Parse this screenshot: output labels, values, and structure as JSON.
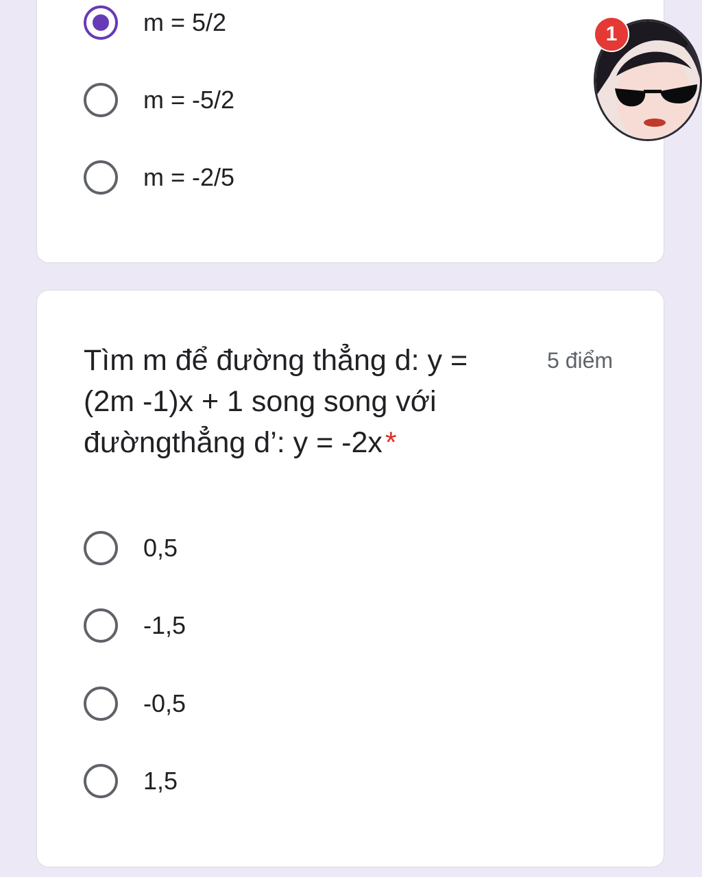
{
  "previous_question": {
    "options": [
      {
        "label": "m = 5/2",
        "selected": true
      },
      {
        "label": "m = -5/2",
        "selected": false
      },
      {
        "label": "m = -2/5",
        "selected": false
      }
    ]
  },
  "question": {
    "title": "Tìm m để đường thẳng d: y = (2m -1)x + 1 song song với đườngthẳng d’: y = -2x",
    "required_marker": "*",
    "points": "5 điểm",
    "options": [
      {
        "label": "0,5",
        "selected": false
      },
      {
        "label": "-1,5",
        "selected": false
      },
      {
        "label": "-0,5",
        "selected": false
      },
      {
        "label": "1,5",
        "selected": false
      }
    ]
  },
  "chat_head": {
    "badge_count": "1",
    "icon": "avatar-photo"
  },
  "colors": {
    "accent": "#673ab7",
    "page_background": "#ece8f6",
    "required": "#d93025",
    "badge": "#e53935"
  }
}
